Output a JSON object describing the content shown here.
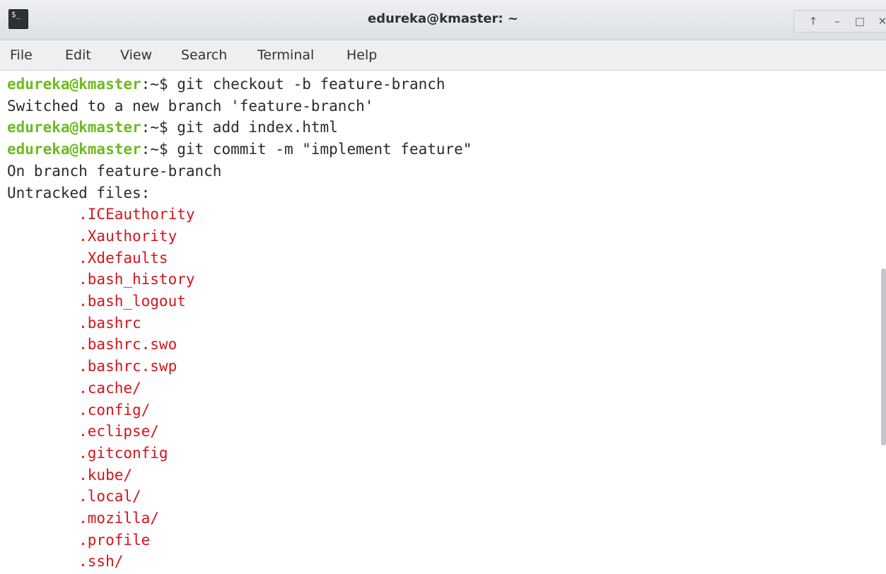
{
  "window": {
    "title": "edureka@kmaster: ~",
    "icon": "terminal-icon",
    "controls": [
      "up-arrow-icon",
      "minimize-icon",
      "maximize-icon",
      "close-icon"
    ]
  },
  "menu": [
    "File",
    "Edit",
    "View",
    "Search",
    "Terminal",
    "Help"
  ],
  "prompt": {
    "user_host": "edureka@kmaster",
    "path": ":~$ "
  },
  "colors": {
    "prompt": "#6dbb1f",
    "untracked": "#d4141c",
    "text": "#2b2b2b"
  },
  "lines": [
    {
      "kind": "cmd",
      "text": "git checkout -b feature-branch"
    },
    {
      "kind": "out",
      "text": "Switched to a new branch 'feature-branch'"
    },
    {
      "kind": "cmd",
      "text": "git add index.html"
    },
    {
      "kind": "cmd",
      "text": "git commit -m \"implement feature\""
    },
    {
      "kind": "out",
      "text": "On branch feature-branch"
    },
    {
      "kind": "out",
      "text": "Untracked files:"
    },
    {
      "kind": "file",
      "text": "        .ICEauthority"
    },
    {
      "kind": "file",
      "text": "        .Xauthority"
    },
    {
      "kind": "file",
      "text": "        .Xdefaults"
    },
    {
      "kind": "file",
      "text": "        .bash_history"
    },
    {
      "kind": "file",
      "text": "        .bash_logout"
    },
    {
      "kind": "file",
      "text": "        .bashrc"
    },
    {
      "kind": "file",
      "text": "        .bashrc.swo"
    },
    {
      "kind": "file",
      "text": "        .bashrc.swp"
    },
    {
      "kind": "file",
      "text": "        .cache/"
    },
    {
      "kind": "file",
      "text": "        .config/"
    },
    {
      "kind": "file",
      "text": "        .eclipse/"
    },
    {
      "kind": "file",
      "text": "        .gitconfig"
    },
    {
      "kind": "file",
      "text": "        .kube/"
    },
    {
      "kind": "file",
      "text": "        .local/"
    },
    {
      "kind": "file",
      "text": "        .mozilla/"
    },
    {
      "kind": "file",
      "text": "        .profile"
    },
    {
      "kind": "file",
      "text": "        .ssh/"
    }
  ]
}
